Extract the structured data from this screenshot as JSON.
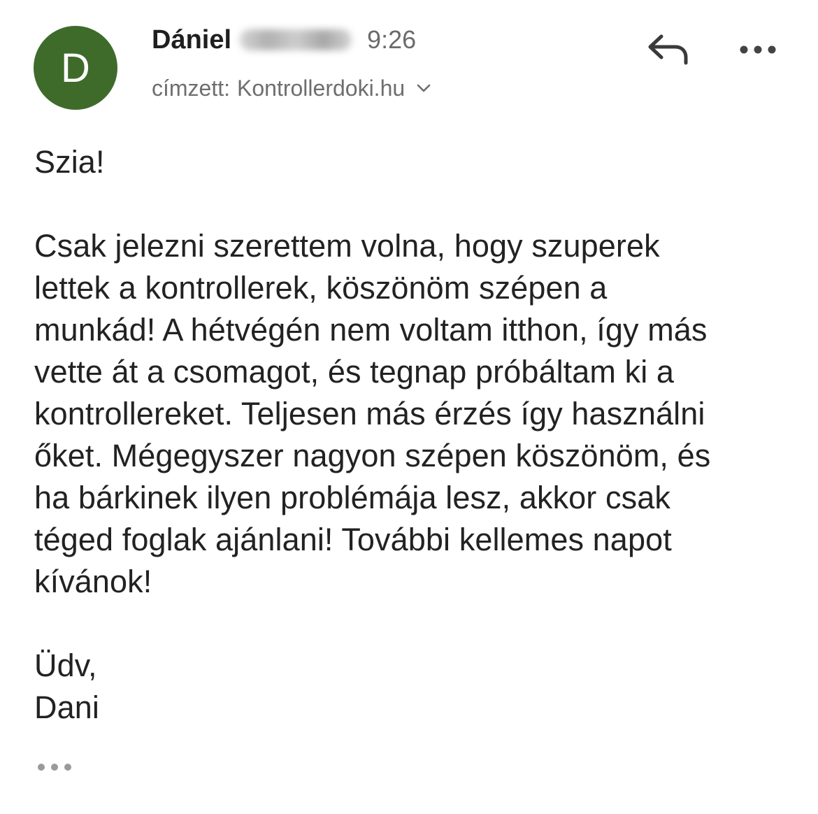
{
  "message": {
    "avatar_letter": "D",
    "avatar_color": "#3e6b2a",
    "sender_name": "Dániel",
    "time": "9:26",
    "recipient_label": "címzett:",
    "recipient_value": "Kontrollerdoki.hu"
  },
  "actions": {
    "reply_icon": "reply-icon",
    "more_icon": "more-horizontal-icon",
    "expand_icon": "chevron-down-icon"
  },
  "body": {
    "greeting": "Szia!",
    "lines": [
      "Csak jelezni szerettem volna, hogy szuperek",
      "lettek a kontrollerek, köszönöm szépen a",
      "munkád! A hétvégén nem voltam itthon, így más",
      "vette át a csomagot, és tegnap próbáltam ki a",
      "kontrollereket. Teljesen más érzés így használni",
      "őket. Mégegyszer nagyon szépen köszönöm, és",
      "ha bárkinek ilyen problémája lesz, akkor csak",
      "téged foglak ajánlani! További kellemes napot",
      "kívánok!"
    ],
    "closing": "Üdv,",
    "signature": "Dani"
  }
}
